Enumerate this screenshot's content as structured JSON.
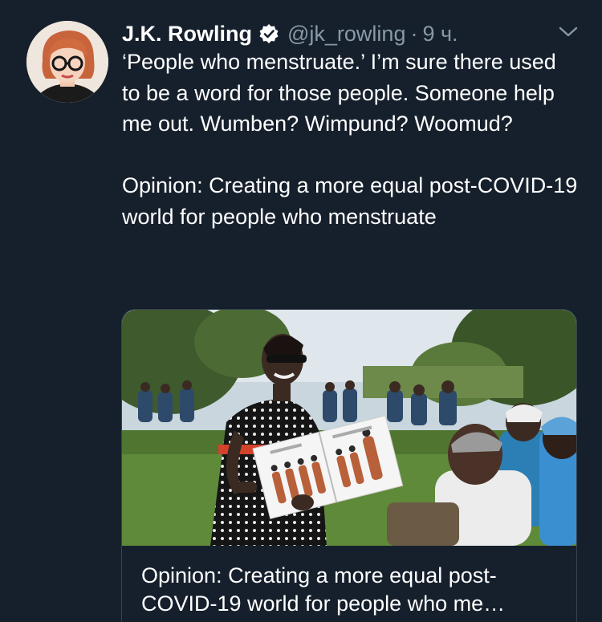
{
  "tweet": {
    "author_name": "J.K. Rowling",
    "handle": "@jk_rowling",
    "separator": "·",
    "time": "9 ч.",
    "text": "‘People who menstruate.’ I’m sure there used to be a word for those people. Someone help me out. Wumben? Wimpund? Woomud?\n\nOpinion: Creating a more equal post-COVID-19 world for people who menstruate",
    "icons": {
      "verified": "verified-badge-icon",
      "menu": "chevron-down-icon"
    }
  },
  "card": {
    "title": "Opinion: Creating a more equal post-COVID-19 world for people who me…",
    "image": "woman-presenting-chart-to-seated-group-photo"
  },
  "colors": {
    "background": "#16202c",
    "text": "#ffffff",
    "muted": "#8899a6",
    "border": "#38444d"
  }
}
